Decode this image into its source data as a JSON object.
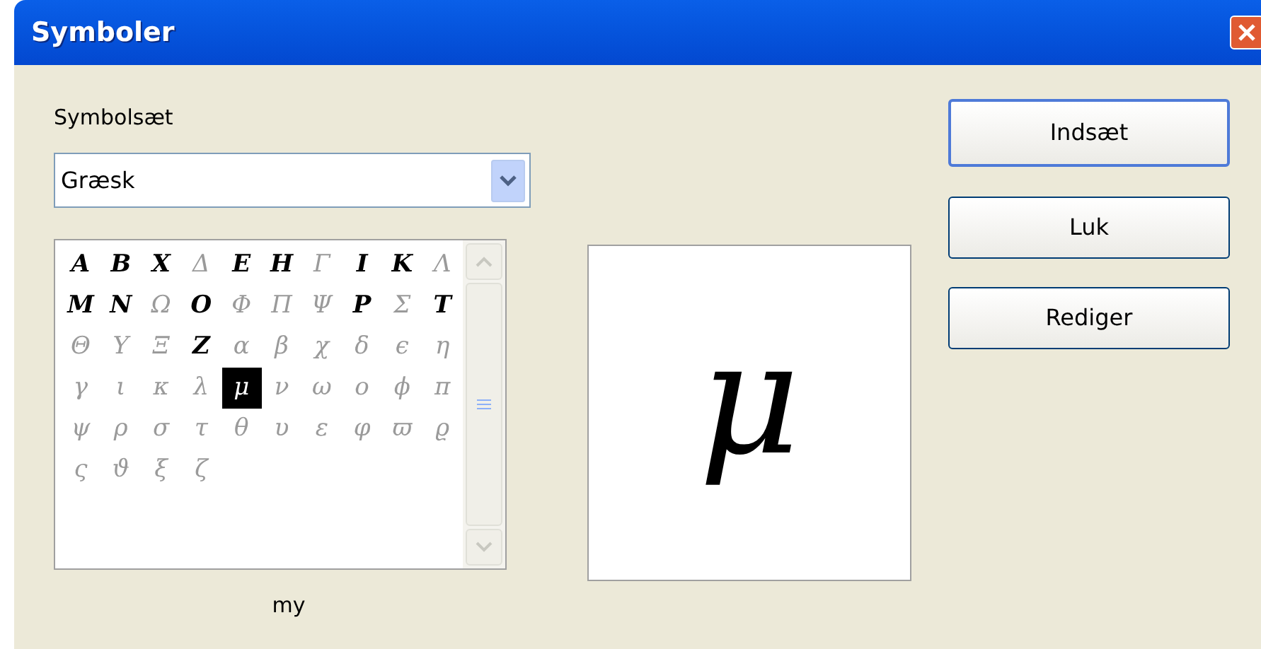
{
  "window": {
    "title": "Symboler"
  },
  "symbol_set": {
    "label": "Symbolsæt",
    "value": "Græsk"
  },
  "symbols": [
    {
      "char": "A",
      "kind": "bold",
      "selected": false
    },
    {
      "char": "B",
      "kind": "bold",
      "selected": false
    },
    {
      "char": "X",
      "kind": "bold",
      "selected": false
    },
    {
      "char": "Δ",
      "kind": "regular",
      "selected": false
    },
    {
      "char": "E",
      "kind": "bold",
      "selected": false
    },
    {
      "char": "H",
      "kind": "bold",
      "selected": false
    },
    {
      "char": "Γ",
      "kind": "regular",
      "selected": false
    },
    {
      "char": "I",
      "kind": "bold",
      "selected": false
    },
    {
      "char": "K",
      "kind": "bold",
      "selected": false
    },
    {
      "char": "Λ",
      "kind": "regular",
      "selected": false
    },
    {
      "char": "M",
      "kind": "bold",
      "selected": false
    },
    {
      "char": "N",
      "kind": "bold",
      "selected": false
    },
    {
      "char": "Ω",
      "kind": "regular",
      "selected": false
    },
    {
      "char": "O",
      "kind": "bold",
      "selected": false
    },
    {
      "char": "Φ",
      "kind": "regular",
      "selected": false
    },
    {
      "char": "Π",
      "kind": "regular",
      "selected": false
    },
    {
      "char": "Ψ",
      "kind": "regular",
      "selected": false
    },
    {
      "char": "P",
      "kind": "bold",
      "selected": false
    },
    {
      "char": "Σ",
      "kind": "regular",
      "selected": false
    },
    {
      "char": "T",
      "kind": "bold",
      "selected": false
    },
    {
      "char": "Θ",
      "kind": "regular",
      "selected": false
    },
    {
      "char": "Υ",
      "kind": "regular",
      "selected": false
    },
    {
      "char": "Ξ",
      "kind": "regular",
      "selected": false
    },
    {
      "char": "Z",
      "kind": "bold",
      "selected": false
    },
    {
      "char": "α",
      "kind": "regular",
      "selected": false
    },
    {
      "char": "β",
      "kind": "regular",
      "selected": false
    },
    {
      "char": "χ",
      "kind": "regular",
      "selected": false
    },
    {
      "char": "δ",
      "kind": "regular",
      "selected": false
    },
    {
      "char": "ϵ",
      "kind": "regular",
      "selected": false
    },
    {
      "char": "η",
      "kind": "regular",
      "selected": false
    },
    {
      "char": "γ",
      "kind": "regular",
      "selected": false
    },
    {
      "char": "ι",
      "kind": "regular",
      "selected": false
    },
    {
      "char": "κ",
      "kind": "regular",
      "selected": false
    },
    {
      "char": "λ",
      "kind": "regular",
      "selected": false
    },
    {
      "char": "μ",
      "kind": "regular",
      "selected": true
    },
    {
      "char": "ν",
      "kind": "regular",
      "selected": false
    },
    {
      "char": "ω",
      "kind": "regular",
      "selected": false
    },
    {
      "char": "ο",
      "kind": "regular",
      "selected": false
    },
    {
      "char": "ϕ",
      "kind": "regular",
      "selected": false
    },
    {
      "char": "π",
      "kind": "regular",
      "selected": false
    },
    {
      "char": "ψ",
      "kind": "regular",
      "selected": false
    },
    {
      "char": "ρ",
      "kind": "regular",
      "selected": false
    },
    {
      "char": "σ",
      "kind": "regular",
      "selected": false
    },
    {
      "char": "τ",
      "kind": "regular",
      "selected": false
    },
    {
      "char": "θ",
      "kind": "regular",
      "selected": false
    },
    {
      "char": "υ",
      "kind": "regular",
      "selected": false
    },
    {
      "char": "ε",
      "kind": "regular",
      "selected": false
    },
    {
      "char": "φ",
      "kind": "regular",
      "selected": false
    },
    {
      "char": "ϖ",
      "kind": "regular",
      "selected": false
    },
    {
      "char": "ϱ",
      "kind": "regular",
      "selected": false
    },
    {
      "char": "ς",
      "kind": "regular",
      "selected": false
    },
    {
      "char": "ϑ",
      "kind": "regular",
      "selected": false
    },
    {
      "char": "ξ",
      "kind": "regular",
      "selected": false
    },
    {
      "char": "ζ",
      "kind": "regular",
      "selected": false
    }
  ],
  "preview": {
    "char": "μ"
  },
  "symbol_name": "my",
  "buttons": [
    {
      "label": "Indsæt",
      "default": true
    },
    {
      "label": "Luk",
      "default": false
    },
    {
      "label": "Rediger",
      "default": false
    }
  ]
}
